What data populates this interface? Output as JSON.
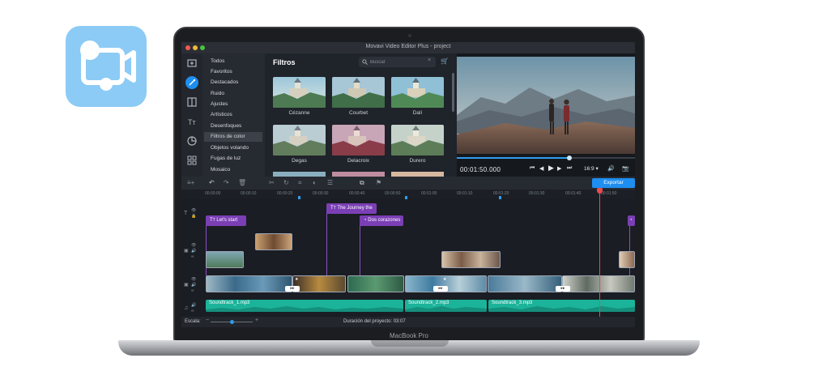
{
  "window": {
    "title": "Movavi Video Editor Plus - project"
  },
  "laptop": {
    "brand": "MacBook Pro"
  },
  "categories": [
    {
      "label": "Todos",
      "active": false
    },
    {
      "label": "Favoritos",
      "active": false
    },
    {
      "label": "Destacados",
      "active": false
    },
    {
      "label": "Ruido",
      "active": false
    },
    {
      "label": "Ajustes",
      "active": false
    },
    {
      "label": "Artísticos",
      "active": false
    },
    {
      "label": "Desenfoques",
      "active": false
    },
    {
      "label": "Filtros de color",
      "active": true
    },
    {
      "label": "Objetos volando",
      "active": false
    },
    {
      "label": "Fugas de luz",
      "active": false
    },
    {
      "label": "Mosaico",
      "active": false
    }
  ],
  "filters": {
    "title": "Filtros",
    "search_placeholder": "Buscar",
    "items": [
      "Cézanne",
      "Courbet",
      "Dalí",
      "Degas",
      "Delacroix",
      "Durero"
    ]
  },
  "preview": {
    "timecode": "00:01:50.000",
    "aspect": "16:9 ▾",
    "progress": 0.63
  },
  "timeline": {
    "export_label": "Exportar",
    "ruler": [
      "00:00:00",
      "00:00:10",
      "00:00:20",
      "00:00:30",
      "00:00:40",
      "00:00:50",
      "00:01:00",
      "00:01:10",
      "00:01:20",
      "00:01:30",
      "00:01:40",
      "00:01:50"
    ],
    "titles": [
      "Let's start",
      "The Journey the",
      "Dos corazones"
    ],
    "audio": [
      "Soundtrack_1.mp3",
      "Soundtrack_2.mp3",
      "Soundtrack_3.mp3"
    ]
  },
  "bottom": {
    "scale_label": "Escala:",
    "duration": "Duración del proyecto:  03:07",
    "zoom": 0.5
  },
  "colors": {
    "accent": "#1e8ef0",
    "title_clip": "#7b3fb5",
    "audio": "#1bb39a",
    "app_icon": "#8ccbf5"
  }
}
